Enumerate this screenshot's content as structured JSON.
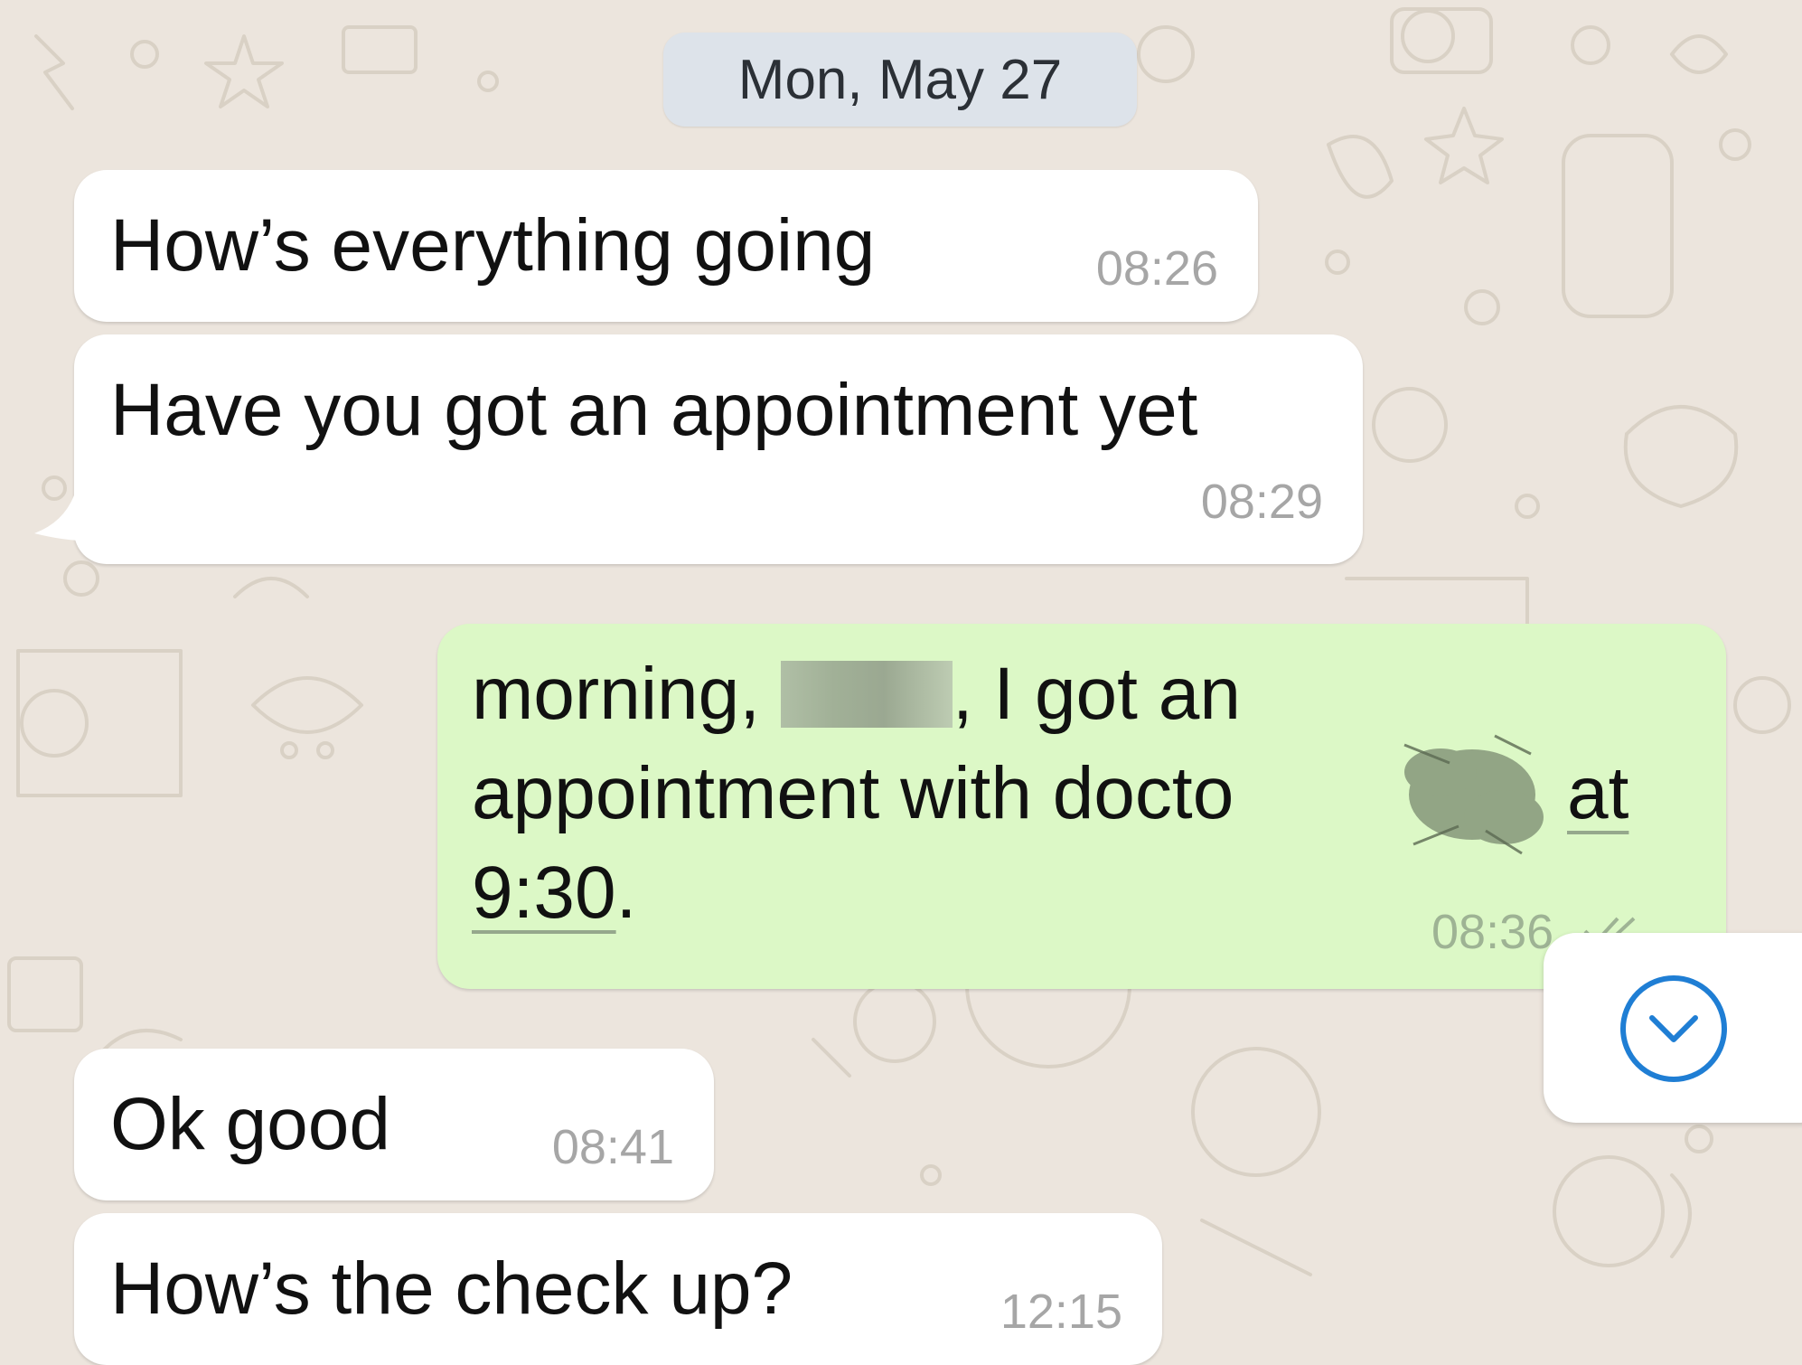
{
  "date_separator": "Mon, May 27",
  "messages": [
    {
      "direction": "incoming",
      "text": "How’s everything going",
      "time": "08:26"
    },
    {
      "direction": "incoming",
      "text": "Have you got an appointment yet",
      "time": "08:29"
    },
    {
      "direction": "outgoing",
      "line1_before": "morning,",
      "line1_after": ", I got an",
      "line2_before": "appointment with docto",
      "line2_after": "at",
      "line3": "9:30",
      "line3_after": ".",
      "time": "08:36",
      "status_icon": "double-check-icon"
    },
    {
      "direction": "incoming",
      "text": "Ok good",
      "time": "08:41"
    },
    {
      "direction": "incoming",
      "text": "How’s the check up?",
      "time": "12:15"
    }
  ],
  "scroll_button_icon": "chevron-down-icon",
  "colors": {
    "background": "#ece5dd",
    "incoming_bubble": "#ffffff",
    "outgoing_bubble": "#dcf8c6",
    "date_pill": "#dde3ea",
    "accent": "#1f7ed4"
  }
}
